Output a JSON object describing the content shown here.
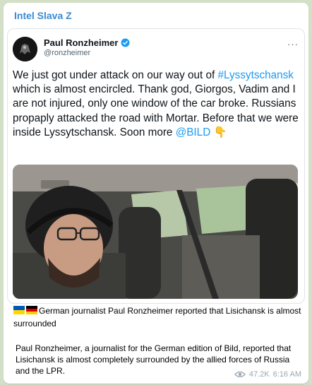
{
  "post": {
    "channel": "Intel Slava Z",
    "views": "47.2K",
    "time": "6:16 AM"
  },
  "tweet": {
    "author": "Paul Ronzheimer",
    "handle": "@ronzheimer",
    "more": "···",
    "text_1": "We just got under attack on our way out of ",
    "hashtag": "#Lyssytschansk",
    "text_2": " which is almost encircled. Thank god, Giorgos, Vadim and I are not injured, only one window of the car broke. Russians propaply attacked the road with Mortar. Before that we were inside Lyssytschansk. Soon more ",
    "mention": "@BILD",
    "emoji": "👇"
  },
  "caption": {
    "flags": [
      "ukraine-flag",
      "germany-flag"
    ],
    "line_1": "German journalist Paul Ronzheimer reported that Lisichansk is almost surrounded",
    "line_2": "Paul Ronzheimer, a journalist for the German edition of Bild, reported that Lisichansk is almost completely surrounded by the allied forces of Russia and the LPR."
  },
  "colors": {
    "background": "#d3dfc7",
    "channel_name": "#3a8ad0",
    "link": "#1d9bf0",
    "meta": "#9aa7b3"
  }
}
